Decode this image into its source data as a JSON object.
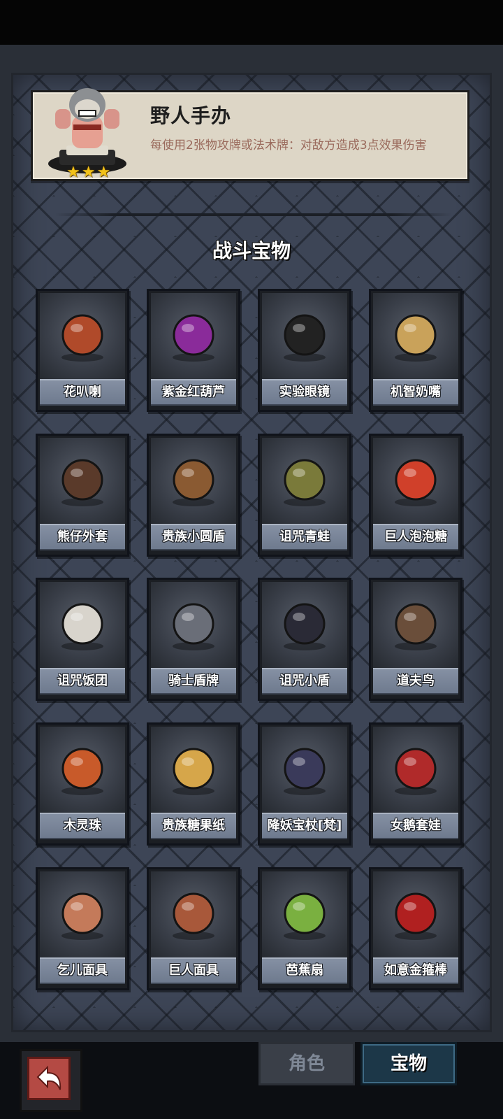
{
  "detail": {
    "name": "野人手办",
    "description": "每使用2张物攻牌或法术牌：对敌方造成3点效果伤害",
    "stars": [
      "★",
      "★",
      "★"
    ],
    "icon": "savage-figurine-icon"
  },
  "section_title": "战斗宝物",
  "items": [
    {
      "label": "花叭喇",
      "icon": "pitcher-plant-icon",
      "color": "#b04a2a"
    },
    {
      "label": "紫金红葫芦",
      "icon": "gourd-icon",
      "color": "#8a2b9a"
    },
    {
      "label": "实验眼镜",
      "icon": "goggles-icon",
      "color": "#222222"
    },
    {
      "label": "机智奶嘴",
      "icon": "pacifier-icon",
      "color": "#c9a25a"
    },
    {
      "label": "熊仔外套",
      "icon": "teddy-bear-icon",
      "color": "#5a3a2a"
    },
    {
      "label": "贵族小圆盾",
      "icon": "round-shield-icon",
      "color": "#8a5a32"
    },
    {
      "label": "诅咒青蛙",
      "icon": "frog-icon",
      "color": "#7a7a3a"
    },
    {
      "label": "巨人泡泡糖",
      "icon": "bubblegum-pack-icon",
      "color": "#d0402a"
    },
    {
      "label": "诅咒饭团",
      "icon": "rice-ball-icon",
      "color": "#d8d4cc"
    },
    {
      "label": "骑士盾牌",
      "icon": "knight-shield-icon",
      "color": "#6a6e78"
    },
    {
      "label": "诅咒小盾",
      "icon": "cursed-shield-icon",
      "color": "#2a2a36"
    },
    {
      "label": "道夫鸟",
      "icon": "owl-icon",
      "color": "#6a4e3a"
    },
    {
      "label": "木灵珠",
      "icon": "wood-spirit-orb-icon",
      "color": "#c85a2a"
    },
    {
      "label": "贵族糖果纸",
      "icon": "candy-wrapper-icon",
      "color": "#d6a64a"
    },
    {
      "label": "降妖宝杖[梵]",
      "icon": "staff-icon",
      "color": "#3a3a5a"
    },
    {
      "label": "女鹅套娃",
      "icon": "matryoshka-icon",
      "color": "#b02a2a"
    },
    {
      "label": "乞儿面具",
      "icon": "beggar-mask-icon",
      "color": "#c47a5a"
    },
    {
      "label": "巨人面具",
      "icon": "giant-mask-icon",
      "color": "#a8583a"
    },
    {
      "label": "芭蕉扇",
      "icon": "banana-leaf-fan-icon",
      "color": "#7ab040"
    },
    {
      "label": "如意金箍棒",
      "icon": "golden-cudgel-icon",
      "color": "#b02020"
    }
  ],
  "tabs": [
    {
      "label": "角色",
      "active": false
    },
    {
      "label": "宝物",
      "active": true
    }
  ],
  "back": {
    "icon": "back-arrow-icon"
  }
}
